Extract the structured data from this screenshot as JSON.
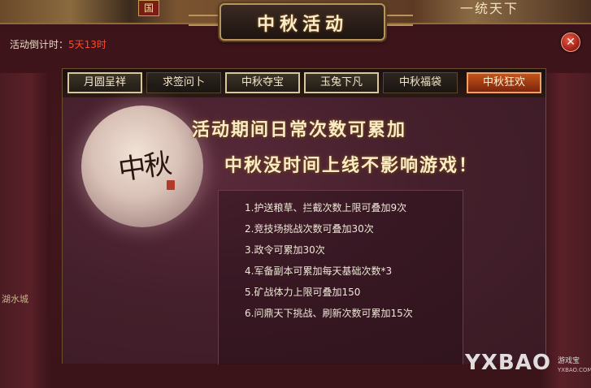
{
  "scene": {
    "top_left_tab": "国",
    "top_right_text": "一统天下",
    "left_map_label": "湖水城"
  },
  "dialog": {
    "title": "中秋活动",
    "countdown_label": "活动倒计时：",
    "countdown_value": "5天13时",
    "close_icon": "close-icon"
  },
  "tabs": [
    {
      "label": "月圆呈祥",
      "state": "highlighted"
    },
    {
      "label": "求签问卜",
      "state": "normal"
    },
    {
      "label": "中秋夺宝",
      "state": "highlighted"
    },
    {
      "label": "玉兔下凡",
      "state": "highlighted"
    },
    {
      "label": "中秋福袋",
      "state": "normal"
    },
    {
      "label": "中秋狂欢",
      "state": "active"
    }
  ],
  "content": {
    "moon_calligraphy": "中秋",
    "headline_1": "活动期间日常次数可累加",
    "headline_2": "中秋没时间上线不影响游戏！",
    "rules": [
      "1.护送粮草、拦截次数上限可叠加9次",
      "2.竞技场挑战次数可叠加30次",
      "3.政令可累加30次",
      "4.军备副本可累加每天基础次数*3",
      "5.矿战体力上限可叠加150",
      "6.问鼎天下挑战、刷新次数可累加15次"
    ]
  },
  "watermark": {
    "brand": "YXBAO",
    "tag": "游戏宝",
    "url": "YXBAO.COM"
  },
  "colors": {
    "active_tab": "#c4531c",
    "countdown_value": "#ff4a2a",
    "title_gold": "#fbecc8"
  }
}
